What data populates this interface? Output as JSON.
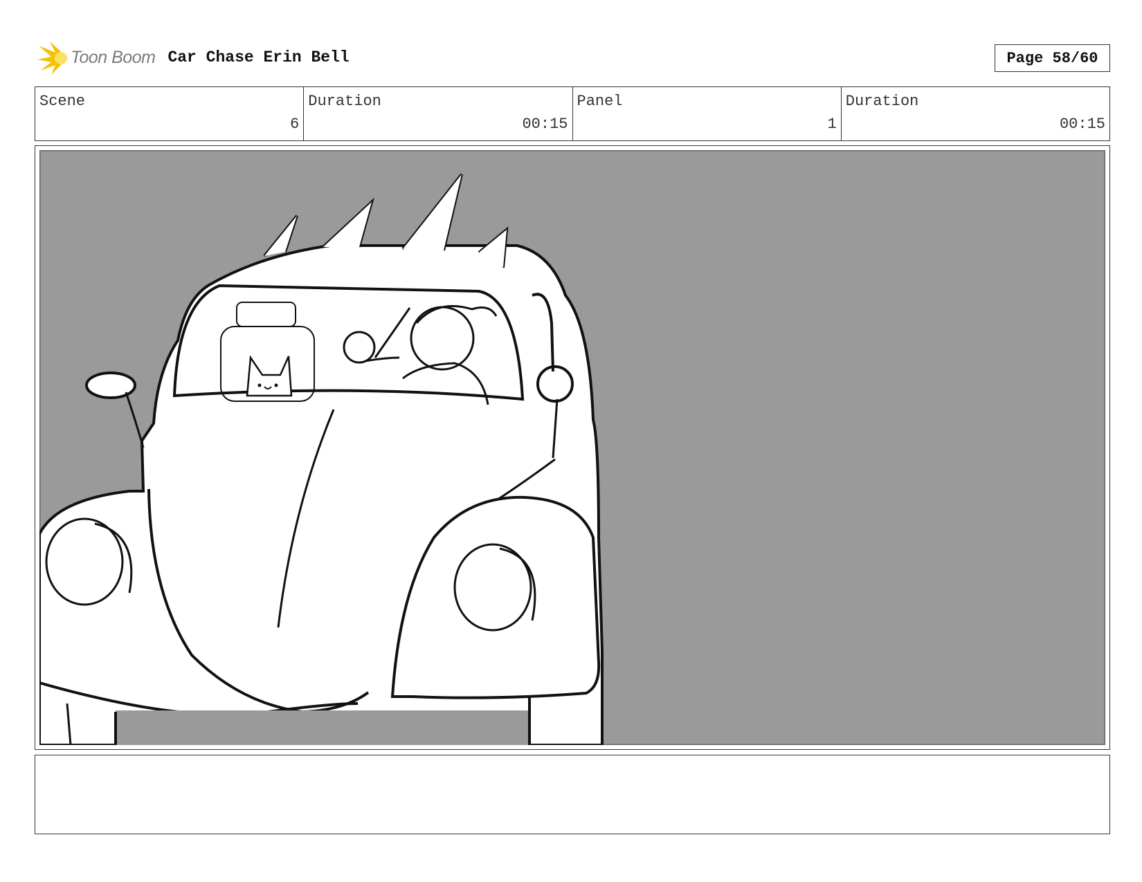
{
  "header": {
    "logo_text": "Toon Boom",
    "project_title": "Car Chase Erin Bell",
    "page_label": "Page 58/60"
  },
  "info": {
    "scene_label": "Scene",
    "scene_value": "6",
    "scene_duration_label": "Duration",
    "scene_duration_value": "00:15",
    "panel_label": "Panel",
    "panel_value": "1",
    "panel_duration_label": "Duration",
    "panel_duration_value": "00:15"
  },
  "panel": {
    "background_color": "#9a9a9a",
    "icons": [
      "toon-boom-logo-icon"
    ]
  },
  "notes": {
    "text": ""
  }
}
